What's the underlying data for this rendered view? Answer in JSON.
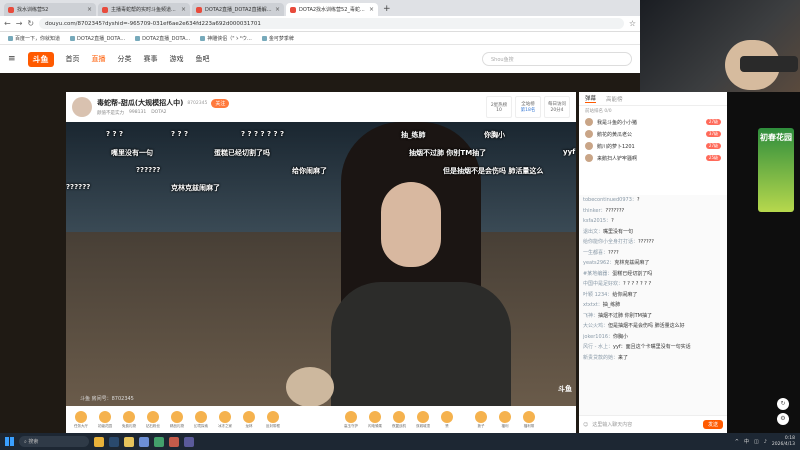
{
  "browser": {
    "tabs": [
      {
        "title": "找水训练营52",
        "active": false
      },
      {
        "title": "主播毒蛇帮的实时斗鱼频道...",
        "active": false
      },
      {
        "title": "DOTA2直播_DOTA2直播解说...",
        "active": false
      },
      {
        "title": "DOTA2找水训练营52_毒蛇...",
        "active": true
      }
    ],
    "url": "douyu.com/8702345?dyshid=-965709-031ef6ae2e634fd223a692d000031701",
    "bookmarks": [
      "百度一下，你就知道",
      "DOTA2直播_DOTA...",
      "DOTA2直播_DOTA...",
      "神雕侠侣（\"ゝ°ウ...",
      "金可梦季稗"
    ]
  },
  "site_nav": {
    "logo": "斗鱼",
    "items": [
      "首页",
      "直播",
      "分类",
      "赛事",
      "游戏",
      "鱼吧"
    ],
    "active": "直播",
    "search_placeholder": "Shou鱼搜"
  },
  "room": {
    "title": "毒蛇帮-甜瓜(大规模招人中)",
    "room_id": "8702345",
    "follow_label": "关注",
    "tags": [
      "颜值不是实力",
      "998131",
      "DOTA2"
    ],
    "buttons": [
      {
        "top": "2星热榜",
        "bottom": "10"
      },
      {
        "top": "全站榜",
        "bottom": "第18名"
      },
      {
        "top": "每日访问",
        "bottom": "20分4"
      }
    ]
  },
  "danmaku": [
    "? ? ?",
    "? ? ?",
    "? ? ? ? ? ? ?",
    "抽_练肺",
    "你胸小",
    "嘴里没有一句",
    "蛋糕已经切割了吗",
    "抽烟不过肺 你别TM抽了",
    "yyf",
    "??????",
    "给你闹麻了",
    "但是抽烟不是会伤吗 肺活量这么",
    "克林克兹闹麻了",
    "??????"
  ],
  "video_watermark": "斗鱼 房间号：8702345",
  "video_logo": "斗鱼",
  "gift_bar": [
    "任务大厅",
    "初级花园",
    "免费礼物",
    "钻石粉丝",
    "精品礼物",
    "幻境探索",
    "冰冻之家",
    "龙林",
    "反封带框",
    "高玉守护",
    "闪电骑乘",
    "夜翼战机",
    "双城城顶",
    "赞",
    "扳子",
    "福利",
    "福利带"
  ],
  "chat": {
    "tabs": [
      "弹幕",
      "高能榜"
    ],
    "rank_header": "前站排名 0/0",
    "top_users": [
      {
        "name": "我是斗鱼的小小猪",
        "level": "27级"
      },
      {
        "name": "鹅花的黄瓜老公",
        "level": "37级"
      },
      {
        "name": "鹅川的萝卜1201",
        "level": "27级"
      },
      {
        "name": "来鹅扫人铲牢骚啊",
        "level": "25级"
      }
    ],
    "messages": [
      {
        "user": "tobecontinued0973：",
        "text": "?"
      },
      {
        "user": "thinker：",
        "text": "???????"
      },
      {
        "user": "ksfa2015：",
        "text": "?"
      },
      {
        "user": "退出文：",
        "text": "嘴里没有一句"
      },
      {
        "user": "给你能你小全身打打话：",
        "text": "??????"
      },
      {
        "user": "一生都喜：",
        "text": "????"
      },
      {
        "user": "yeats2962：",
        "text": "克林克兹闹麻了"
      },
      {
        "user": "#某地编器：",
        "text": "蛋糕已经切割了吗"
      },
      {
        "user": "中国中是足好欢：",
        "text": "? ? ? ? ? ? ?"
      },
      {
        "user": "叶颖 1234：",
        "text": "给你闹麻了"
      },
      {
        "user": "xtxtxt：",
        "text": "抽_练肺"
      },
      {
        "user": "飞神：",
        "text": "抽烟不过肺 你别TM抽了"
      },
      {
        "user": "大公火鸡：",
        "text": "但是抽烟不是会伤吗 肺活量这么好"
      },
      {
        "user": "joker1016：",
        "text": "你胸小"
      },
      {
        "user": "风行 - 水上：",
        "text": "yyf：面且这个卡嘴里没有一句实话"
      },
      {
        "user": "新贵贷款的她：",
        "text": "来了"
      }
    ],
    "input_placeholder": "这里输入聊天内容",
    "send_label": "发送"
  },
  "side_banner": "初春花园",
  "taskbar": {
    "search_placeholder": "搜索",
    "ime": "中",
    "time": "0:18",
    "date": "2026/4/13"
  }
}
